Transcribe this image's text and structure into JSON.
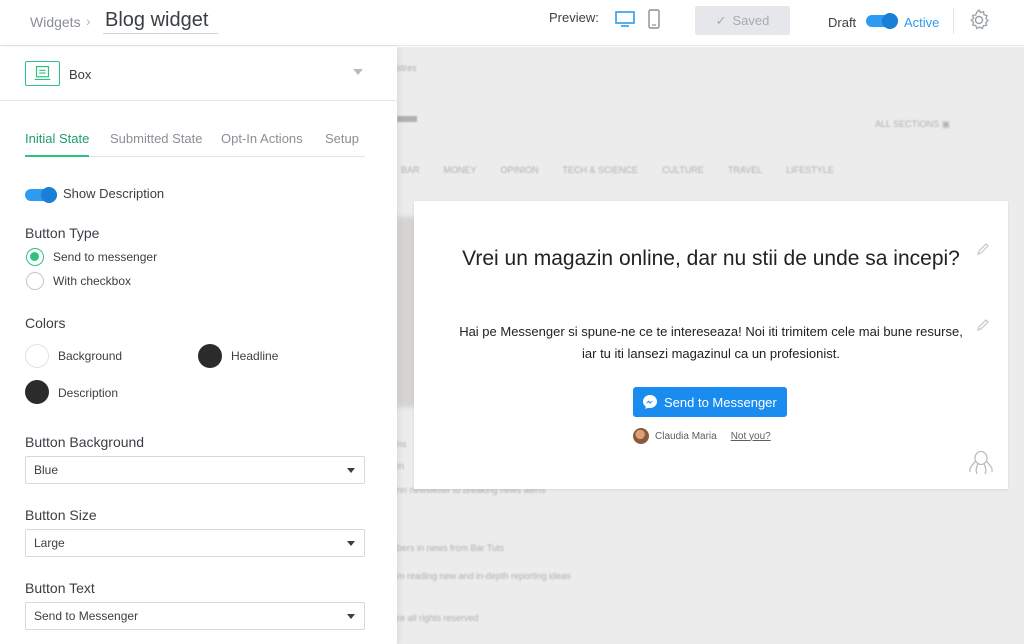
{
  "header": {
    "breadcrumb": "Widgets",
    "title": "Blog widget",
    "preview_label": "Preview:",
    "saved_label": "Saved",
    "draft_label": "Draft",
    "active_label": "Active"
  },
  "panel": {
    "widget_type": "Box",
    "tabs": [
      {
        "label": "Initial State",
        "active": true
      },
      {
        "label": "Submitted State",
        "active": false
      },
      {
        "label": "Opt-In Actions",
        "active": false
      },
      {
        "label": "Setup",
        "active": false
      }
    ],
    "show_description_label": "Show Description",
    "show_description_on": true,
    "button_type_title": "Button Type",
    "button_types": [
      {
        "label": "Send to messenger",
        "selected": true
      },
      {
        "label": "With checkbox",
        "selected": false
      }
    ],
    "colors_title": "Colors",
    "colors": [
      {
        "label": "Background",
        "value": "#ffffff"
      },
      {
        "label": "Headline",
        "value": "#2b2b2b"
      },
      {
        "label": "Description",
        "value": "#2b2b2b"
      }
    ],
    "button_background_title": "Button Background",
    "button_background_value": "Blue",
    "button_size_title": "Button Size",
    "button_size_value": "Large",
    "button_text_title": "Button Text",
    "button_text_value": "Send to Messenger"
  },
  "preview": {
    "headline": "Vrei un magazin online, dar nu stii de unde sa incepi?",
    "description": "Hai pe Messenger si spune-ne ce te intereseaza! Noi iti trimitem cele mai bune resurse, iar tu iti lansezi magazinul ca un profesionist.",
    "button_label": "Send to Messenger",
    "user_name": "Claudia Maria",
    "not_you": "Not you?"
  },
  "colors": {
    "accent_green": "#2ec27e",
    "toggle_blue": "#2d9bf0",
    "messenger_blue": "#1a8cf0"
  }
}
